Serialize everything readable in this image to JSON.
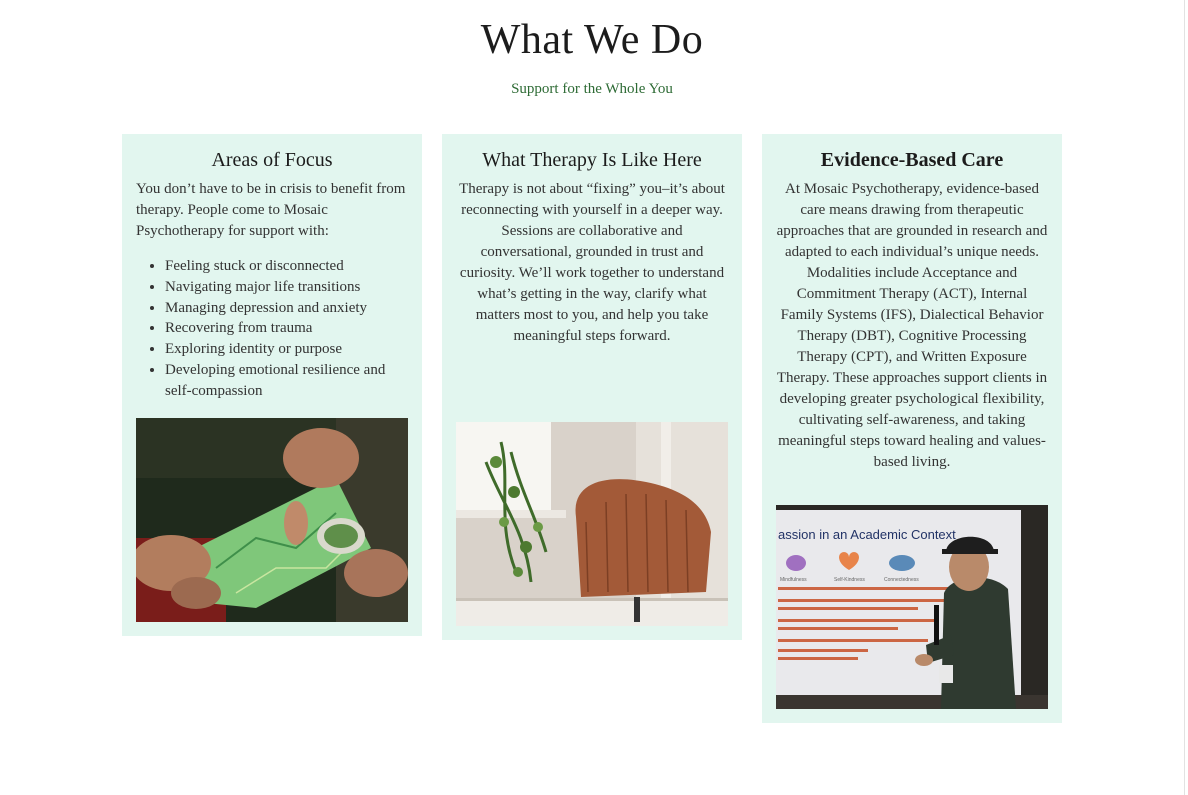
{
  "header": {
    "title": "What We Do",
    "subtitle": "Support for the Whole You"
  },
  "cards": [
    {
      "title": "Areas of Focus",
      "intro": "You don’t have to be in crisis to benefit from therapy. People come to Mosaic Psychotherapy for support with:",
      "items": [
        "Feeling stuck or disconnected",
        "Navigating major life transitions",
        "Managing depression and anxiety",
        "Recovering from trauma",
        "Exploring identity or purpose",
        "Developing emotional resilience and self-compassion"
      ]
    },
    {
      "title": "What Therapy Is Like Here",
      "body": "Therapy is not about “fixing” you–it’s about reconnecting with yourself in a deeper way. Sessions are collaborative and conversational, grounded in trust and curiosity. We’ll work together to understand what’s getting in the way, clarify what matters most to you, and help you take meaningful steps forward."
    },
    {
      "title": "Evidence-Based Care",
      "body": "At Mosaic Psychotherapy, evidence-based care means drawing from therapeutic approaches that are grounded in research and adapted to each individual’s unique needs. Modalities include Acceptance and Commitment Therapy (ACT), Internal Family Systems (IFS), Dialectical Behavior Therapy (DBT), Cognitive Processing Therapy (CPT), and Written Exposure Therapy. These approaches support clients in developing greater psychological flexibility, cultivating self-awareness, and taking meaningful steps toward healing and values-based living.",
      "slide_title": "assion in an Academic Context",
      "slide_icons": [
        "Mindfulness",
        "Self-Kindness",
        "Connectedness"
      ]
    }
  ]
}
